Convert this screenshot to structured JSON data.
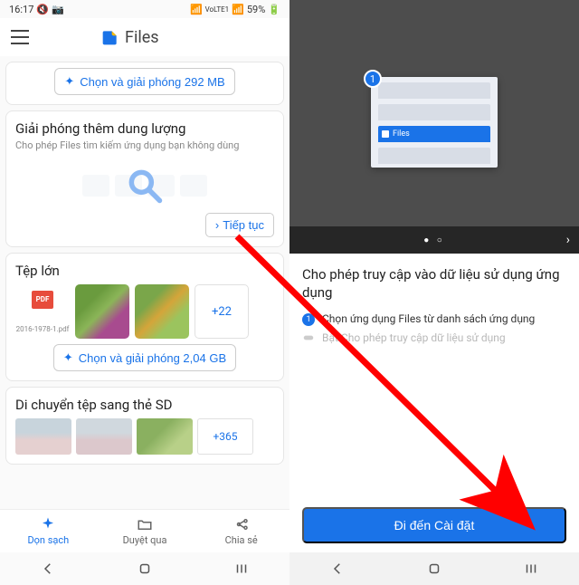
{
  "statusbar": {
    "time": "16:17",
    "signal": "VoLTE1",
    "battery": "59%"
  },
  "app": {
    "name": "Files"
  },
  "clean_card": {
    "button": "Chọn và giải phóng 292 MB"
  },
  "free_card": {
    "title": "Giải phóng thêm dung lượng",
    "subtitle": "Cho phép Files tìm kiếm ứng dụng bạn không dùng",
    "continue": "Tiếp tục"
  },
  "large_card": {
    "title": "Tệp lớn",
    "pdf_badge": "PDF",
    "pdf_name": "2016-1978-1.pdf",
    "more": "+22",
    "button": "Chọn và giải phóng 2,04 GB"
  },
  "sd_card": {
    "title": "Di chuyển tệp sang thẻ SD",
    "more": "+365"
  },
  "bottom_nav": {
    "clean": "Dọn sạch",
    "browse": "Duyệt qua",
    "share": "Chia sẻ"
  },
  "right": {
    "illus_badge": "1",
    "illus_app": "Files",
    "title": "Cho phép truy cập vào dữ liệu sử dụng ứng dụng",
    "step1": "Chọn ứng dụng Files từ danh sách ứng dụng",
    "step2": "Bật Cho phép truy cập dữ liệu sử dụng",
    "cta": "Đi đến Cài đặt"
  }
}
